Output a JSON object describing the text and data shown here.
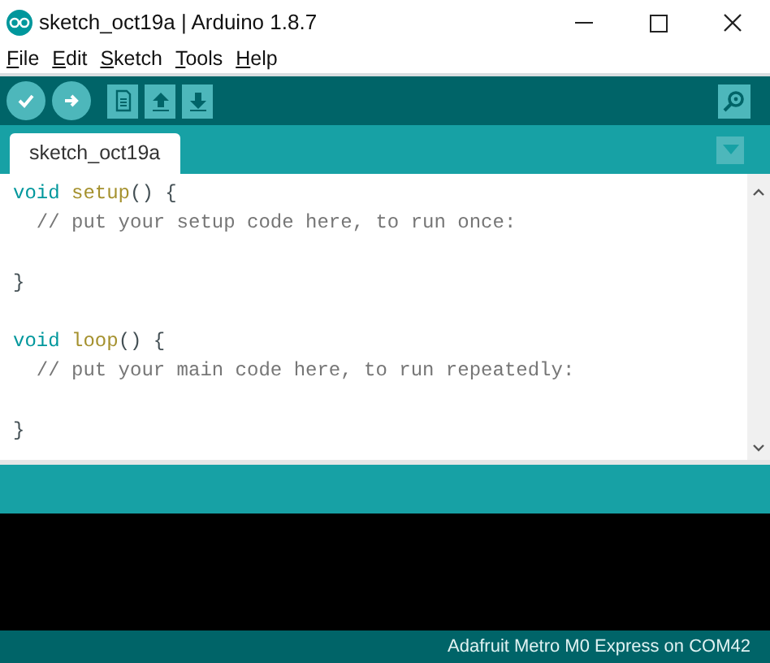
{
  "window": {
    "title": "sketch_oct19a | Arduino 1.8.7"
  },
  "menu": [
    "File",
    "Edit",
    "Sketch",
    "Tools",
    "Help"
  ],
  "tabs": [
    {
      "label": "sketch_oct19a",
      "selected": true
    }
  ],
  "code_lines": [
    {
      "kind": "code",
      "tokens": [
        {
          "kind": "keyword",
          "text": "void"
        },
        {
          "kind": "function",
          "text": "setup"
        },
        {
          "kind": "plain",
          "text": "() {"
        }
      ]
    },
    {
      "kind": "code",
      "tokens": [
        {
          "kind": "comment",
          "text": "// put your setup code here, to run once:"
        }
      ]
    },
    {
      "kind": "blank"
    },
    {
      "kind": "code",
      "tokens": [
        {
          "kind": "plain",
          "text": "}"
        }
      ]
    },
    {
      "kind": "blank"
    },
    {
      "kind": "code",
      "tokens": [
        {
          "kind": "keyword",
          "text": "void"
        },
        {
          "kind": "function",
          "text": "loop"
        },
        {
          "kind": "plain",
          "text": "() {"
        }
      ]
    },
    {
      "kind": "code",
      "tokens": [
        {
          "kind": "comment",
          "text": "// put your main code here, to run repeatedly:"
        }
      ]
    },
    {
      "kind": "blank"
    },
    {
      "kind": "code",
      "tokens": [
        {
          "kind": "plain",
          "text": "}"
        }
      ]
    }
  ],
  "status_bar": {
    "board": "Adafruit Metro M0 Express on COM42"
  }
}
